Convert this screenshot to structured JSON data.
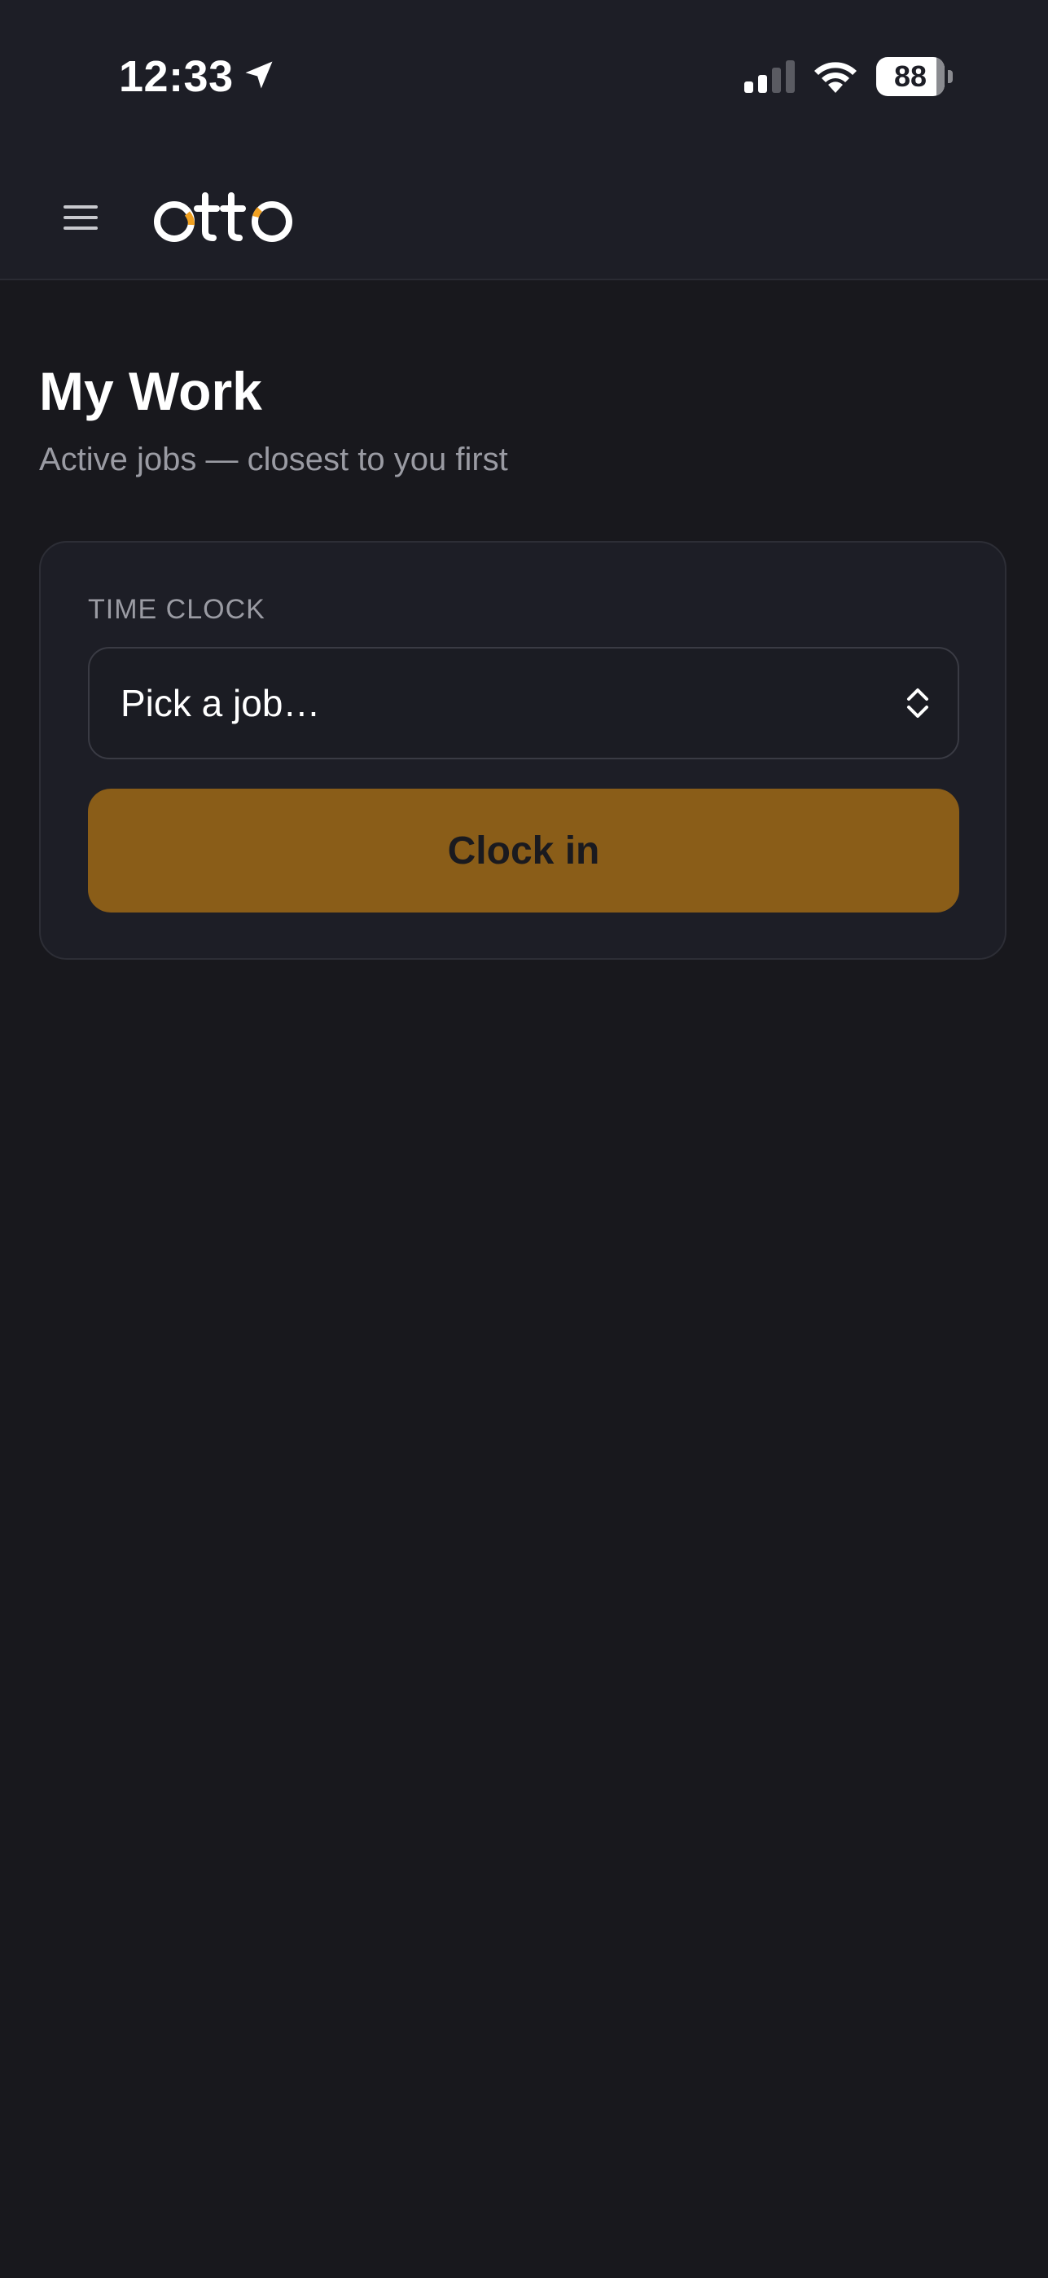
{
  "status_bar": {
    "time": "12:33",
    "battery_level": "88",
    "battery_fraction": 0.88,
    "icons": [
      "location-arrow-icon",
      "cellular-signal-icon",
      "wifi-icon",
      "battery-icon"
    ]
  },
  "app_bar": {
    "logo_text": "otto",
    "menu_icon": "hamburger-menu-icon"
  },
  "page": {
    "title": "My Work",
    "subtitle": "Active jobs — closest to you first"
  },
  "time_clock": {
    "label": "TIME CLOCK",
    "job_select": {
      "placeholder": "Pick a job…",
      "icon": "select-chevron-icon"
    },
    "clock_in_label": "Clock in"
  },
  "colors": {
    "background": "#18181d",
    "header": "#1d1e26",
    "accent_button": "#8a5d18",
    "logo_accent": "#f0a020",
    "muted_text": "#9a9ba3"
  }
}
